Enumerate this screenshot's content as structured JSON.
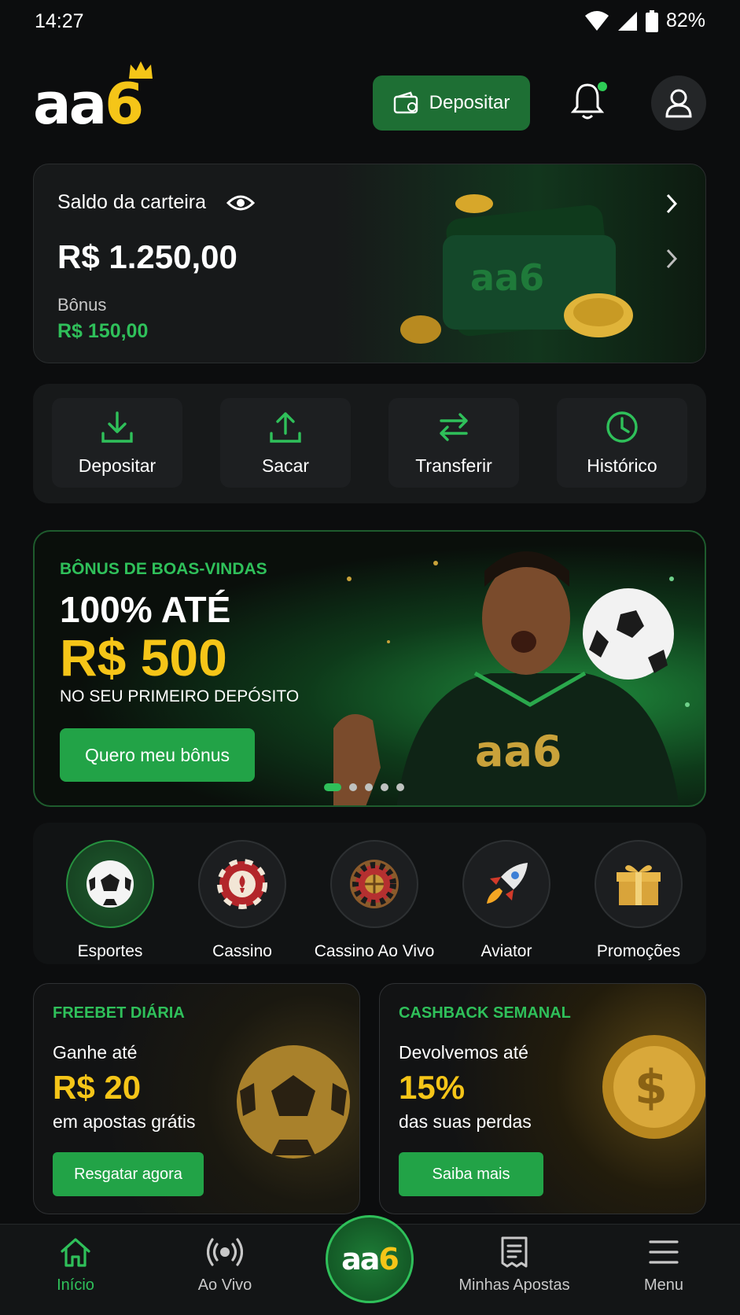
{
  "status_bar": {
    "time": "14:27",
    "battery": "82%"
  },
  "header": {
    "logo_main": "aa",
    "logo_accent": "6",
    "deposit_label": "Depositar"
  },
  "wallet": {
    "label": "Saldo da carteira",
    "balance": "R$ 1.250,00",
    "bonus_label": "Bônus",
    "bonus_amount": "R$ 150,00"
  },
  "quick_actions": [
    {
      "label": "Depositar",
      "icon": "download-icon"
    },
    {
      "label": "Sacar",
      "icon": "upload-icon"
    },
    {
      "label": "Transferir",
      "icon": "transfer-icon"
    },
    {
      "label": "Histórico",
      "icon": "clock-icon"
    }
  ],
  "banner": {
    "eyebrow": "BÔNUS DE BOAS-VINDAS",
    "headline": "100% ATÉ",
    "amount": "R$ 500",
    "subline": "NO SEU PRIMEIRO DEPÓSITO",
    "cta": "Quero meu bônus",
    "jersey_logo": "aa6",
    "slides": 5,
    "active_slide": 1
  },
  "categories": [
    {
      "label": "Esportes",
      "icon": "soccer-ball-icon",
      "active": true
    },
    {
      "label": "Cassino",
      "icon": "casino-chip-icon",
      "active": false
    },
    {
      "label": "Cassino Ao Vivo",
      "icon": "roulette-icon",
      "active": false
    },
    {
      "label": "Aviator",
      "icon": "rocket-icon",
      "active": false
    },
    {
      "label": "Promoções",
      "icon": "gift-icon",
      "active": false
    }
  ],
  "promos": [
    {
      "eyebrow": "FREEBET DIÁRIA",
      "line1": "Ganhe até",
      "big": "R$ 20",
      "line2": "em apostas grátis",
      "cta": "Resgatar agora"
    },
    {
      "eyebrow": "CASHBACK SEMANAL",
      "line1": "Devolvemos até",
      "big": "15%",
      "line2": "das suas perdas",
      "cta": "Saiba mais"
    }
  ],
  "bottom_nav": {
    "items": [
      {
        "label": "Início",
        "icon": "home-icon",
        "active": true
      },
      {
        "label": "Ao Vivo",
        "icon": "live-broadcast-icon",
        "active": false
      },
      {
        "label": "Minhas Apostas",
        "icon": "betslip-icon",
        "active": false
      },
      {
        "label": "Menu",
        "icon": "hamburger-menu-icon",
        "active": false
      }
    ],
    "center_main": "aa",
    "center_accent": "6"
  },
  "colors": {
    "brand_green": "#22a347",
    "accent_gold": "#f5c518",
    "text_green": "#2fc05a",
    "background": "#0c0d0e"
  }
}
